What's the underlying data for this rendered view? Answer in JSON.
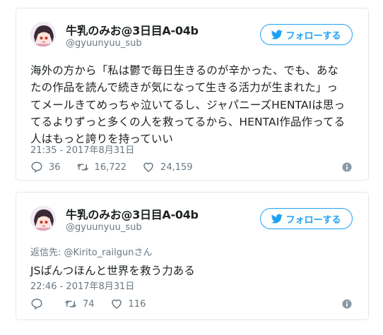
{
  "tweets": [
    {
      "author_name": "牛乳のみお@3日目A-04b",
      "author_handle": "@gyuunyuu_sub",
      "follow_label": "フォローする",
      "text_lines": [
        "海外の方から「私は鬱で毎日生きるのが辛かった、でも、あな",
        "たの作品を読んで続きが気になって生きる活力が生まれた」っ",
        "てメールきてめっちゃ泣いてるし、ジャパニーズHENTAIは思っ",
        "てるよりずっと多くの人を救ってるから、HENTAI作品作ってる",
        "人はもっと誇りを持っていい"
      ],
      "timestamp": "21:35 - 2017年8月31日",
      "replies": "36",
      "retweets": "16,722",
      "likes": "24,159"
    },
    {
      "author_name": "牛乳のみお@3日目A-04b",
      "author_handle": "@gyuunyuu_sub",
      "follow_label": "フォローする",
      "reply_prefix": "返信先: ",
      "reply_user": "@Kirito_railgun",
      "reply_suffix": "さん",
      "text": "JSぱんつほんと世界を救う力ある",
      "timestamp": "22:46 - 2017年8月31日",
      "replies": "",
      "retweets": "74",
      "likes": "116"
    }
  ],
  "colors": {
    "brand_blue": "#1da1f2",
    "secondary_text": "#697882",
    "border": "#e1e8ed"
  },
  "icons": [
    "twitter-bird-icon",
    "reply-icon",
    "retweet-icon",
    "heart-icon",
    "info-icon",
    "avatar"
  ]
}
